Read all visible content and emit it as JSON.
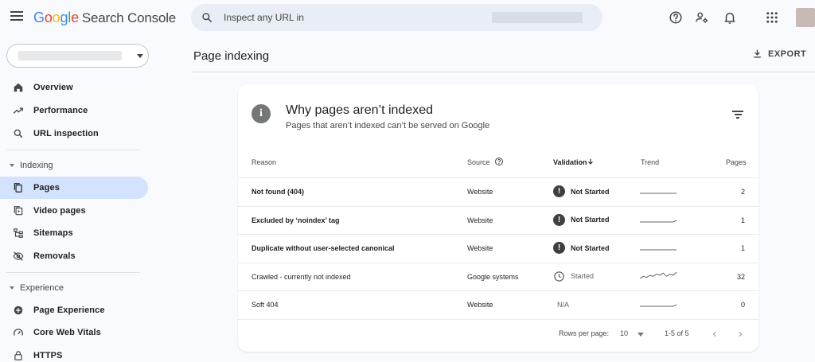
{
  "header": {
    "logo_google": "Google",
    "logo_product": "Search Console",
    "search_placeholder": "Inspect any URL in"
  },
  "sidebar": {
    "nav": [
      {
        "label": "Overview",
        "icon": "home-icon"
      },
      {
        "label": "Performance",
        "icon": "trending-up-icon"
      },
      {
        "label": "URL inspection",
        "icon": "search-icon"
      }
    ],
    "indexing": {
      "label": "Indexing",
      "items": [
        {
          "label": "Pages",
          "icon": "pages-icon",
          "active": true
        },
        {
          "label": "Video pages",
          "icon": "video-pages-icon"
        },
        {
          "label": "Sitemaps",
          "icon": "sitemap-icon"
        },
        {
          "label": "Removals",
          "icon": "visibility-off-icon"
        }
      ]
    },
    "experience": {
      "label": "Experience",
      "items": [
        {
          "label": "Page Experience",
          "icon": "page-experience-icon"
        },
        {
          "label": "Core Web Vitals",
          "icon": "speedometer-icon"
        },
        {
          "label": "HTTPS",
          "icon": "lock-icon"
        }
      ]
    }
  },
  "main": {
    "title": "Page indexing",
    "export_label": "EXPORT",
    "card": {
      "title": "Why pages aren’t indexed",
      "subtitle": "Pages that aren’t indexed can’t be served on Google",
      "columns": {
        "reason": "Reason",
        "source": "Source",
        "validation": "Validation",
        "trend": "Trend",
        "pages": "Pages"
      },
      "rows": [
        {
          "reason": "Not found (404)",
          "source": "Website",
          "validation": "Not Started",
          "status": "error",
          "pages": "2",
          "trend": [
            1,
            1,
            1,
            1,
            1,
            1,
            1,
            1,
            1,
            1,
            1,
            1
          ]
        },
        {
          "reason": "Excluded by ‘noindex’ tag",
          "source": "Website",
          "validation": "Not Started",
          "status": "error",
          "pages": "1",
          "trend": [
            1,
            1,
            1,
            1,
            1,
            1,
            1,
            1,
            1,
            1,
            1,
            1.3
          ]
        },
        {
          "reason": "Duplicate without user-selected canonical",
          "source": "Website",
          "validation": "Not Started",
          "status": "error",
          "pages": "1",
          "trend": [
            1,
            1,
            1,
            1,
            1,
            1,
            1,
            1,
            1,
            1,
            1,
            1
          ]
        },
        {
          "reason": "Crawled - currently not indexed",
          "source": "Google systems",
          "validation": "Started",
          "status": "started",
          "pages": "32",
          "trend": [
            28,
            30,
            29,
            31,
            30,
            32,
            31,
            33,
            30,
            32,
            31,
            34
          ]
        },
        {
          "reason": "Soft 404",
          "source": "Website",
          "validation": "N/A",
          "status": "na",
          "pages": "0",
          "trend": [
            0,
            0,
            0,
            0,
            0,
            0,
            0,
            0,
            0,
            0,
            0,
            0.3
          ]
        }
      ],
      "footer": {
        "rows_per_page_label": "Rows per page:",
        "rows_per_page_value": "10",
        "range": "1-5 of 5"
      }
    }
  },
  "colors": {
    "accent": "#d3e3fd",
    "search_bg": "#e9eef6",
    "page_bg": "#f8fafd"
  }
}
